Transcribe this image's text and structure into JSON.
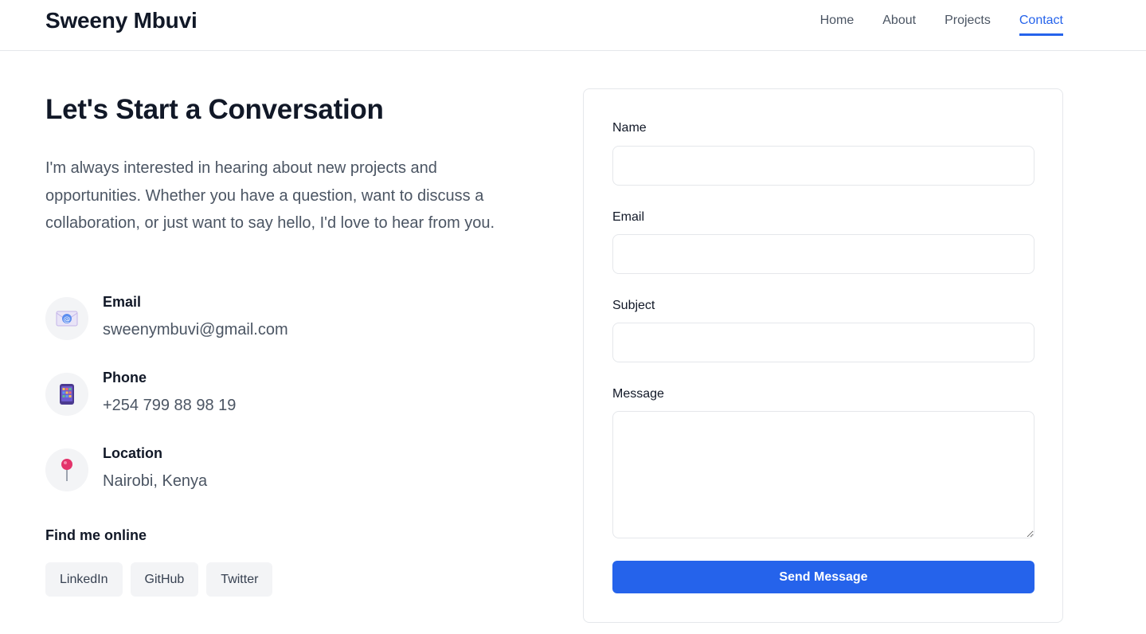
{
  "header": {
    "logo": "Sweeny Mbuvi",
    "nav": [
      "Home",
      "About",
      "Projects",
      "Contact"
    ],
    "active_nav": "Contact"
  },
  "intro": {
    "headline": "Let's Start a Conversation",
    "paragraph": "I'm always interested in hearing about new projects and opportunities. Whether you have a question, want to discuss a collaboration, or just want to say hello, I'd love to hear from you."
  },
  "contact": {
    "email": {
      "label": "Email",
      "value": "sweenymbuvi@gmail.com",
      "icon": "envelope-icon"
    },
    "phone": {
      "label": "Phone",
      "value": "+254 799 88 98 19",
      "icon": "mobile-phone-icon"
    },
    "location": {
      "label": "Location",
      "value": "Nairobi, Kenya",
      "icon": "pin-icon"
    }
  },
  "social": {
    "title": "Find me online",
    "links": [
      "LinkedIn",
      "GitHub",
      "Twitter"
    ]
  },
  "form": {
    "name_label": "Name",
    "email_label": "Email",
    "subject_label": "Subject",
    "message_label": "Message",
    "submit_label": "Send Message"
  },
  "colors": {
    "accent": "#2563eb",
    "text": "#111827",
    "muted": "#4b5563",
    "border": "#e5e7eb"
  }
}
